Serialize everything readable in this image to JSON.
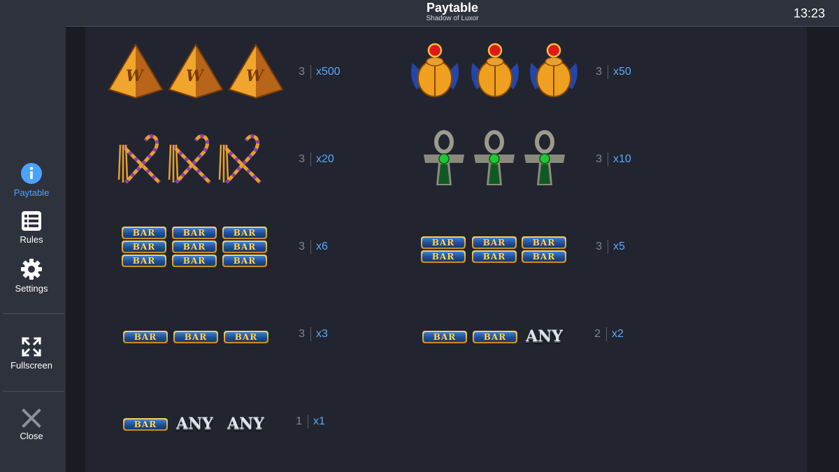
{
  "header": {
    "title": "Paytable",
    "subtitle": "Shadow of Luxor",
    "clock": "13:23"
  },
  "sidebar": {
    "items": [
      {
        "label": "Paytable",
        "icon": "info-icon",
        "active": true
      },
      {
        "label": "Rules",
        "icon": "list-icon",
        "active": false
      },
      {
        "label": "Settings",
        "icon": "gear-icon",
        "active": false
      },
      {
        "label": "Fullscreen",
        "icon": "fullscreen-icon",
        "active": false
      },
      {
        "label": "Close",
        "icon": "close-icon",
        "active": false
      }
    ]
  },
  "colors": {
    "accent": "#4aa3ff",
    "multiplier": "#5aa8ff",
    "background": "#22252f",
    "sidebar": "#2e323d"
  },
  "paytable": [
    {
      "symbols": [
        "pyramid-wild",
        "pyramid-wild",
        "pyramid-wild"
      ],
      "count": "3",
      "multiplier": "x500"
    },
    {
      "symbols": [
        "scarab",
        "scarab",
        "scarab"
      ],
      "count": "3",
      "multiplier": "x50"
    },
    {
      "symbols": [
        "crook-flail",
        "crook-flail",
        "crook-flail"
      ],
      "count": "3",
      "multiplier": "x20"
    },
    {
      "symbols": [
        "ankh",
        "ankh",
        "ankh"
      ],
      "count": "3",
      "multiplier": "x10"
    },
    {
      "symbols": [
        "triple-bar",
        "triple-bar",
        "triple-bar"
      ],
      "count": "3",
      "multiplier": "x6"
    },
    {
      "symbols": [
        "double-bar",
        "double-bar",
        "double-bar"
      ],
      "count": "3",
      "multiplier": "x5"
    },
    {
      "symbols": [
        "single-bar",
        "single-bar",
        "single-bar"
      ],
      "count": "3",
      "multiplier": "x3"
    },
    {
      "symbols": [
        "single-bar",
        "single-bar",
        "any"
      ],
      "count": "2",
      "multiplier": "x2"
    },
    {
      "symbols": [
        "single-bar",
        "any",
        "any"
      ],
      "count": "1",
      "multiplier": "x1"
    }
  ],
  "symbol_text": {
    "bar": "BAR",
    "any": "ANY",
    "wild": "W"
  }
}
